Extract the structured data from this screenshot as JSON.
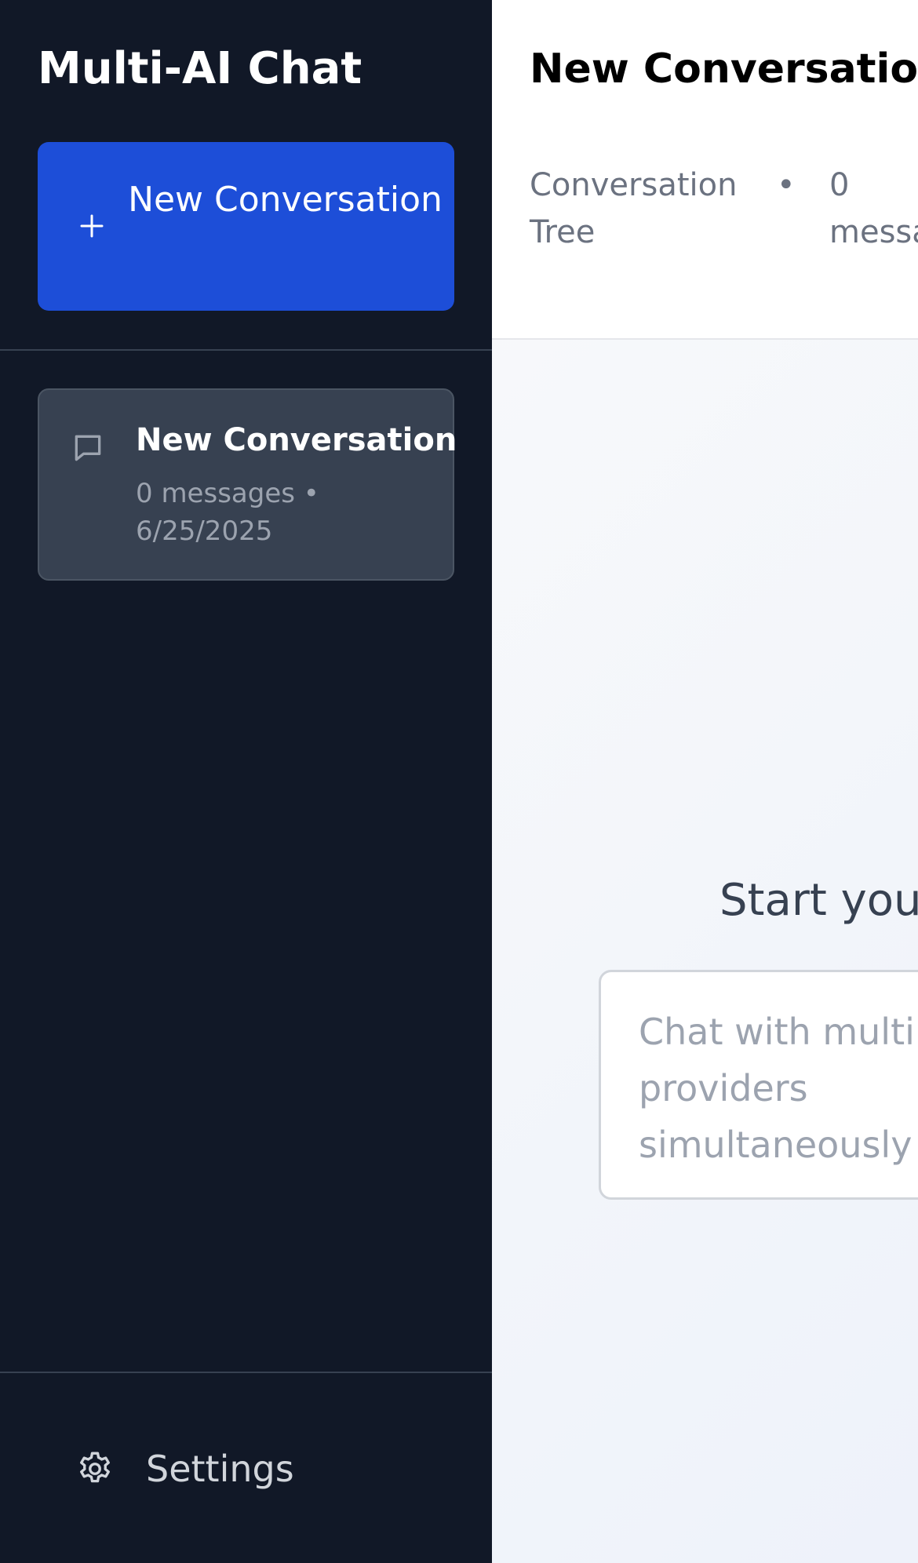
{
  "sidebar": {
    "app_title": "Multi-AI Chat",
    "new_conversation_button": {
      "label": "New Conversation",
      "icon": "plus-icon"
    },
    "conversations": [
      {
        "title": "New Conversation",
        "meta": "0 messages • 6/25/2025",
        "icon": "chat-bubble-icon"
      }
    ],
    "settings": {
      "label": "Settings",
      "icon": "gear-icon"
    }
  },
  "main": {
    "header": {
      "title": "New Conversation",
      "subtitle_left": "Conversation Tree",
      "separator": "•",
      "subtitle_right": "0\nmessa"
    },
    "empty_state": {
      "heading": "Start your"
    },
    "chat_input": {
      "placeholder": "Chat with multiple AI providers simultaneously"
    }
  },
  "colors": {
    "sidebar_bg": "#111827",
    "accent": "#1d4ed8",
    "conversation_item_bg": "#374151",
    "main_bg": "#f9fafb"
  }
}
